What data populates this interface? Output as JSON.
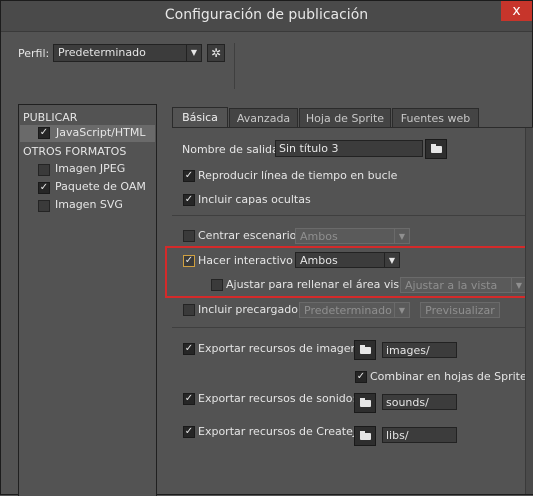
{
  "window": {
    "title": "Configuración de publicación",
    "close_glyph": "x"
  },
  "profile": {
    "label": "Perfil:",
    "value": "Predeterminado"
  },
  "left_panel": {
    "publish_header": "PUBLICAR",
    "publish_items": [
      {
        "label": "JavaScript/HTML",
        "checked": true
      }
    ],
    "other_header": "OTROS FORMATOS",
    "other_items": [
      {
        "label": "Imagen JPEG",
        "checked": false
      },
      {
        "label": "Paquete de OAM",
        "checked": true
      },
      {
        "label": "Imagen SVG",
        "checked": false
      }
    ]
  },
  "tabs": [
    "Básica",
    "Avanzada",
    "Hoja de Sprite",
    "Fuentes web"
  ],
  "basic": {
    "output_name_label": "Nombre de salida:",
    "output_name_value": "Sin título 3",
    "loop_label": "Reproducir línea de tiempo en bucle",
    "hidden_layers_label": "Incluir capas ocultas",
    "center_stage_label": "Centrar escenario",
    "center_stage_value": "Ambos",
    "responsive_label": "Hacer interactivo",
    "responsive_value": "Ambos",
    "scale_fill_label": "Ajustar para rellenar el área visible",
    "scale_fill_value": "Ajustar a la vista",
    "preloader_label": "Incluir precargador",
    "preloader_value": "Predeterminado",
    "preview_button": "Previsualizar",
    "export_images_label": "Exportar recursos de imagen:",
    "export_images_path": "images/",
    "combine_sprites_label": "Combinar en hojas de Sprite",
    "export_sounds_label": "Exportar recursos de sonido:",
    "export_sounds_path": "sounds/",
    "export_createjs_label": "Exportar recursos de CreateJS:",
    "export_createjs_path": "libs/"
  },
  "checkbox_glyph": "✓",
  "dropdown_glyph": "▼",
  "gear_glyph": "✲",
  "colors": {
    "highlight_border": "#d42a2a",
    "close_button": "#c7352b",
    "panel": "#535353"
  }
}
